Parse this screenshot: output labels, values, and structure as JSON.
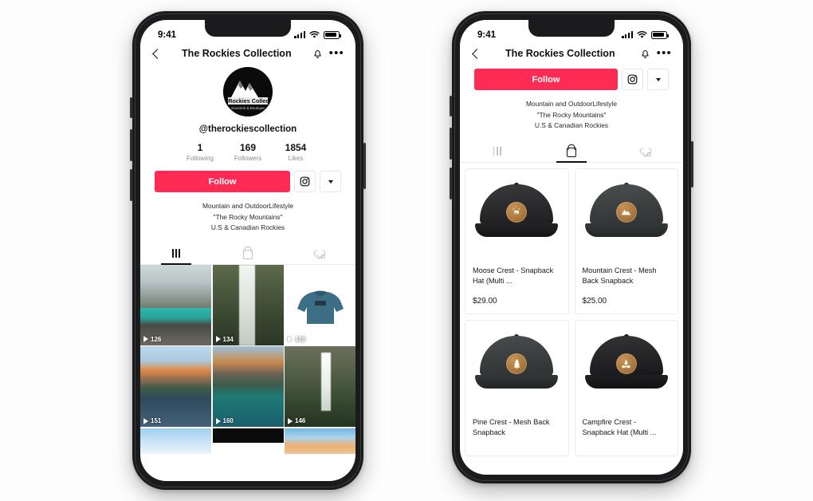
{
  "brand": {
    "accent": "#FE2C55",
    "badge_brown": "#A8763C"
  },
  "phones": {
    "left": {
      "status": {
        "time": "9:41",
        "signal_icon": "signal-bars-icon",
        "wifi_icon": "wifi-icon",
        "battery_icon": "battery-icon"
      },
      "nav": {
        "back_icon": "back-chevron-icon",
        "title": "The Rockies Collection",
        "bell_icon": "bell-icon",
        "more_icon": "more-options-icon"
      },
      "profile": {
        "avatar_alt": "The Rockies Collection Souvenir & Boutique logo",
        "avatar_text_top": "The Rockies Collection",
        "avatar_text_bottom": "Souvenir & Boutique",
        "handle": "@therockiescollection",
        "stats": [
          {
            "num": "1",
            "label": "Following"
          },
          {
            "num": "169",
            "label": "Followers"
          },
          {
            "num": "1854",
            "label": "Likes"
          }
        ],
        "follow_label": "Follow",
        "instagram_icon": "instagram-icon",
        "dropdown_icon": "chevron-down-icon",
        "bio_lines": [
          "Mountain and OutdoorLifestyle",
          "\"The Rocky Mountains\"",
          "U.S & Canadian Rockies"
        ]
      },
      "tabs": [
        {
          "name": "videos",
          "icon": "grid-icon",
          "active": true
        },
        {
          "name": "shop",
          "icon": "shopping-bag-icon",
          "active": false
        },
        {
          "name": "liked",
          "icon": "heart-lock-icon",
          "active": false
        }
      ],
      "videos": [
        {
          "views": "126",
          "scene": "mountain-road-lake",
          "style": "sc-road"
        },
        {
          "views": "134",
          "scene": "waterfall-forest",
          "style": "sc-fall"
        },
        {
          "views": "128",
          "scene": "blue-hoodie-product",
          "style": "sc-hoodie"
        },
        {
          "views": "151",
          "scene": "maroon-bells-reflection",
          "style": "sc-maroon"
        },
        {
          "views": "160",
          "scene": "moraine-lake-reflection",
          "style": "sc-moraine"
        },
        {
          "views": "146",
          "scene": "takakkaw-falls",
          "style": "sc-takak"
        }
      ],
      "videos_partial": [
        {
          "scene": "sky-partial",
          "style": "sc-sky"
        },
        {
          "scene": "dark-partial",
          "style": "sc-dark"
        },
        {
          "scene": "sunset-sky-partial",
          "style": "sc-sunset"
        }
      ]
    },
    "right": {
      "status": {
        "time": "9:41",
        "signal_icon": "signal-bars-icon",
        "wifi_icon": "wifi-icon",
        "battery_icon": "battery-icon"
      },
      "nav": {
        "back_icon": "back-chevron-icon",
        "title": "The Rockies Collection",
        "bell_icon": "bell-icon",
        "more_icon": "more-options-icon"
      },
      "profile": {
        "follow_label": "Follow",
        "instagram_icon": "instagram-icon",
        "dropdown_icon": "chevron-down-icon",
        "bio_lines": [
          "Mountain and OutdoorLifestyle",
          "\"The Rocky Mountains\"",
          "U.S & Canadian Rockies"
        ]
      },
      "tabs": [
        {
          "name": "videos",
          "icon": "grid-icon",
          "active": false
        },
        {
          "name": "shop",
          "icon": "shopping-bag-icon",
          "active": true
        },
        {
          "name": "liked",
          "icon": "heart-lock-icon",
          "active": false
        }
      ],
      "products": [
        {
          "name": "Moose Crest - Snapback Hat (Multi ...",
          "price": "$29.00",
          "crest": "moose-crest-icon",
          "hat_color": "#2a2a2c"
        },
        {
          "name": "Mountain Crest - Mesh Back Snapback",
          "price": "$25.00",
          "crest": "mountain-crest-icon",
          "hat_color": "#3c3f40"
        },
        {
          "name": "Pine Crest - Mesh Back Snapback",
          "price": "",
          "crest": "pine-tree-crest-icon",
          "hat_color": "#3a3d3e"
        },
        {
          "name": "Campfire Crest - Snapback Hat (Multi ...",
          "price": "",
          "crest": "campfire-crest-icon",
          "hat_color": "#242426"
        }
      ]
    }
  }
}
